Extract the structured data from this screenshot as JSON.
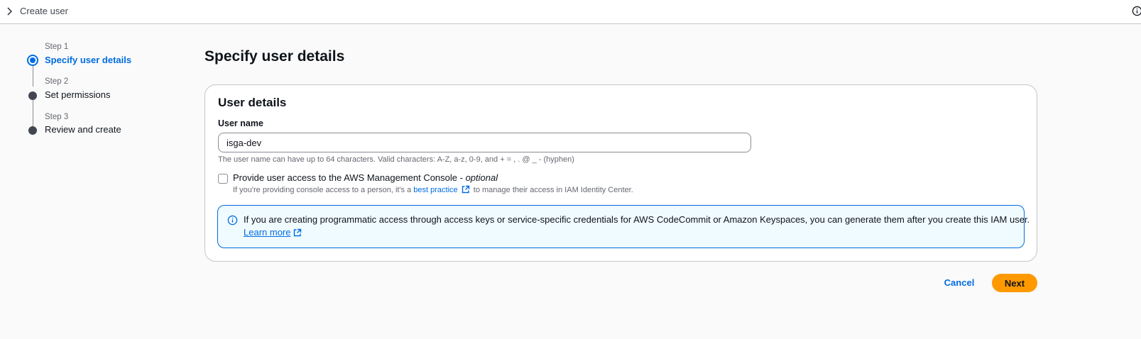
{
  "breadcrumb": {
    "current": "Create user"
  },
  "steps": [
    {
      "number": "Step 1",
      "title": "Specify user details",
      "active": true
    },
    {
      "number": "Step 2",
      "title": "Set permissions",
      "active": false
    },
    {
      "number": "Step 3",
      "title": "Review and create",
      "active": false
    }
  ],
  "page": {
    "title": "Specify user details"
  },
  "user_details": {
    "header": "User details",
    "username_label": "User name",
    "username_value": "isga-dev",
    "username_hint": "The user name can have up to 64 characters. Valid characters: A-Z, a-z, 0-9, and + = , . @ _ - (hyphen)",
    "console_access": {
      "label": "Provide user access to the AWS Management Console - ",
      "optional": "optional",
      "checked": false,
      "desc_before": "If you're providing console access to a person, it's a ",
      "desc_link": "best practice",
      "desc_after": " to manage their access in IAM Identity Center."
    },
    "alert": {
      "message": "If you are creating programmatic access through access keys or service-specific credentials for AWS CodeCommit or Amazon Keyspaces, you can generate them after you create this IAM user.",
      "link": "Learn more"
    }
  },
  "actions": {
    "cancel": "Cancel",
    "next": "Next"
  },
  "colors": {
    "accent": "#006ce0",
    "primary_button": "#ff9900",
    "alert_bg": "#f0fbff"
  },
  "icons": [
    "chevron-right-icon",
    "info-icon",
    "external-link-icon"
  ]
}
